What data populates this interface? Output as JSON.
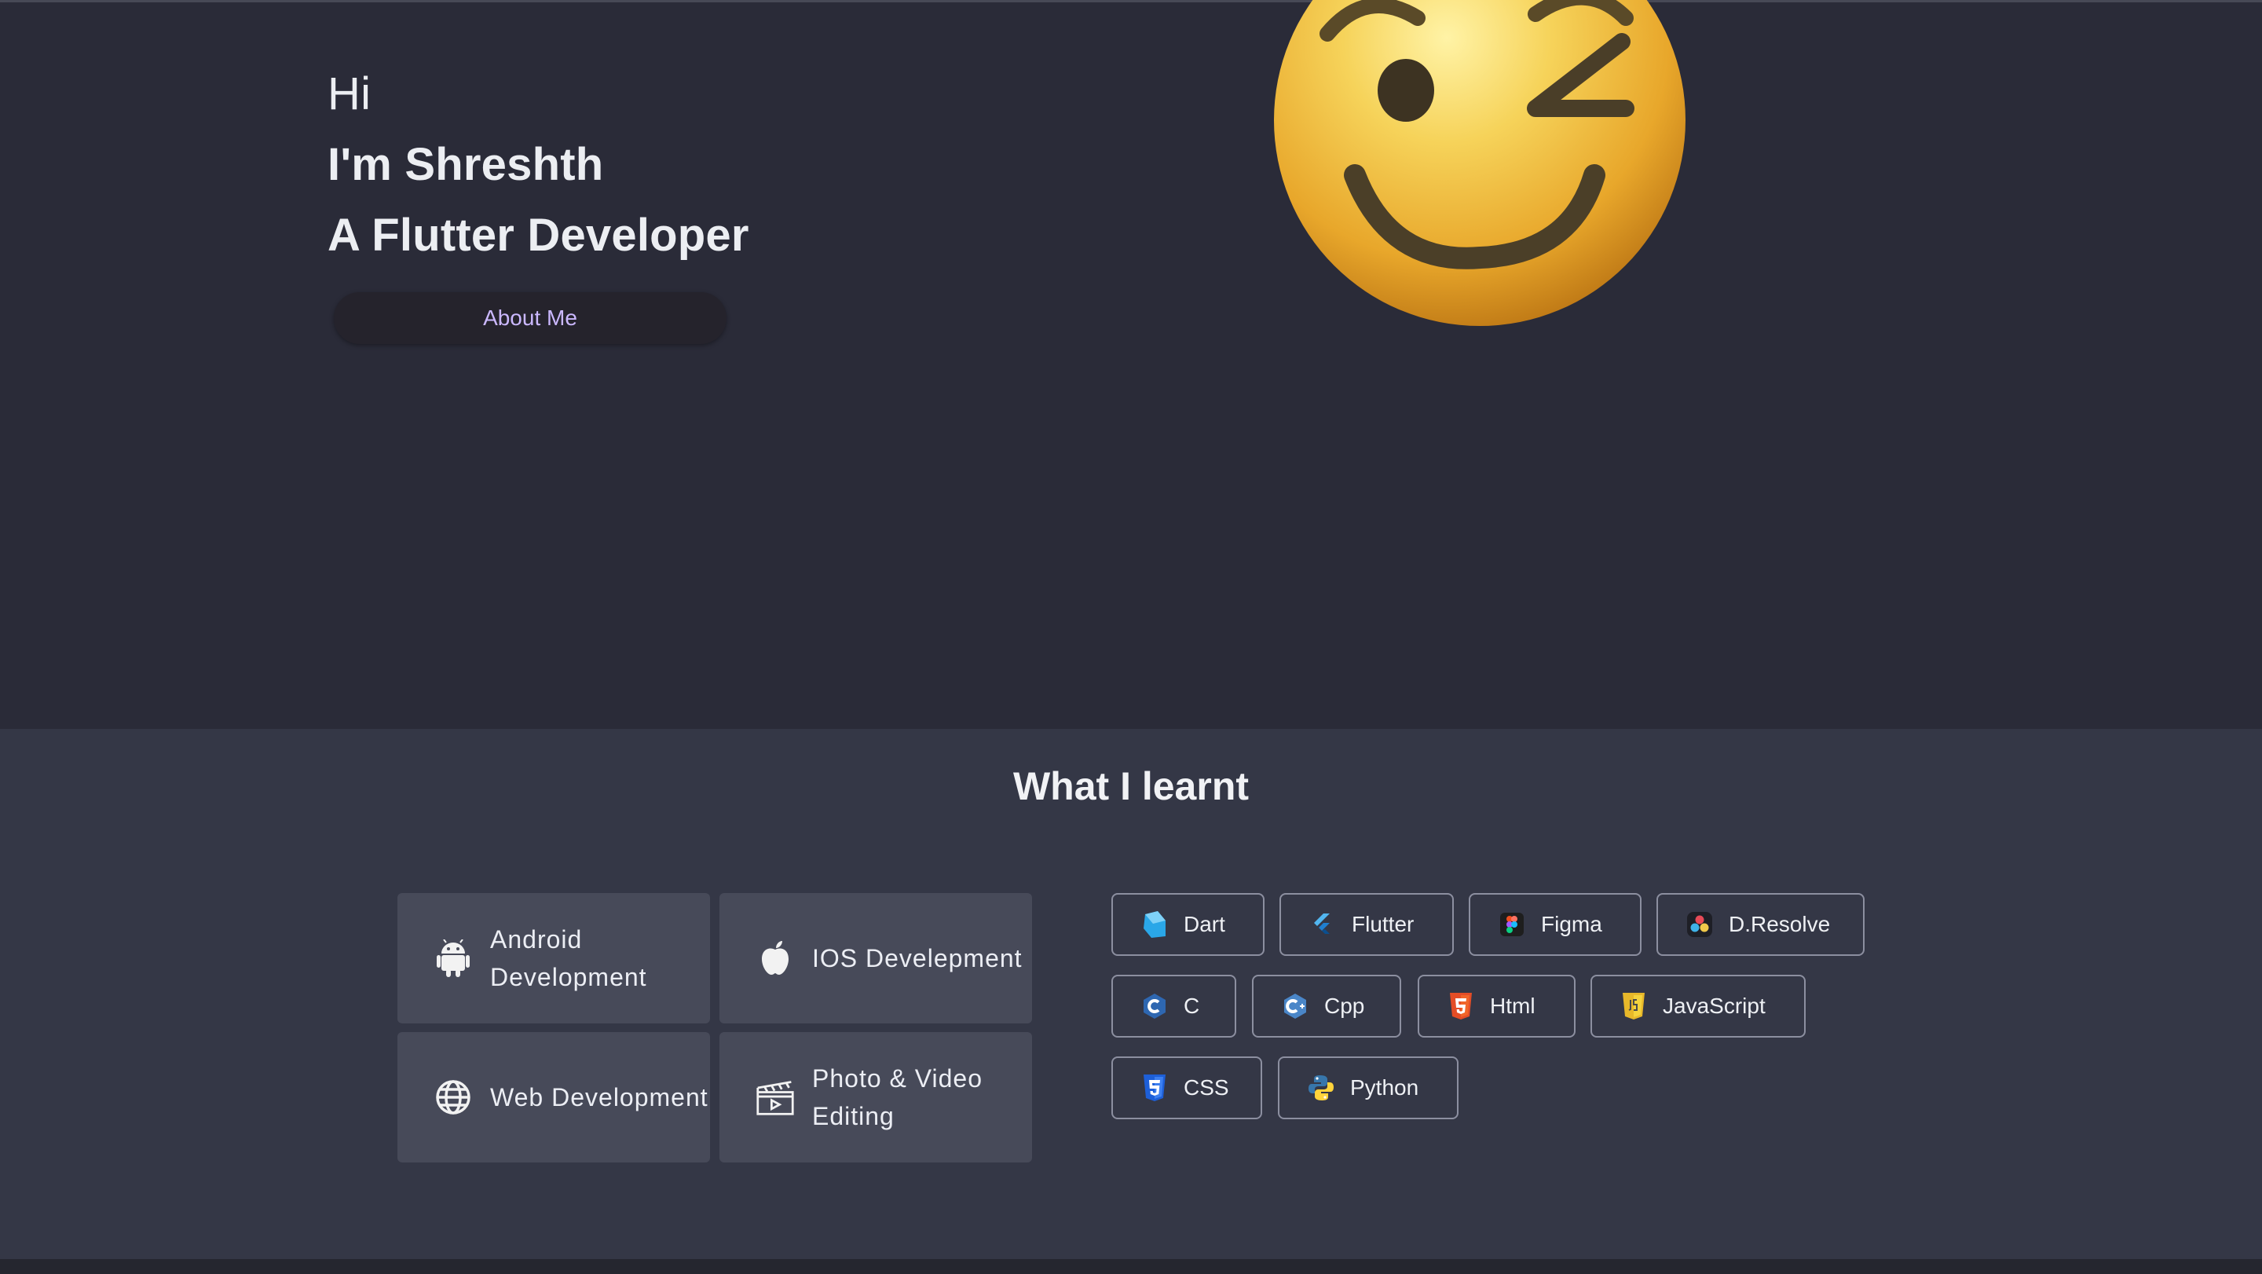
{
  "hero": {
    "line1": "Hi",
    "line2": "I'm Shreshth",
    "line3": "A Flutter Developer",
    "button_label": "About Me",
    "emoji": "winking-face-emoji"
  },
  "learnt": {
    "title": "What I learnt",
    "cards": [
      {
        "label": "Android Development",
        "icon": "android-icon"
      },
      {
        "label": "IOS Develepment",
        "icon": "apple-icon"
      },
      {
        "label": "Web Development",
        "icon": "globe-icon"
      },
      {
        "label": "Photo & Video Editing",
        "icon": "clapperboard-icon"
      }
    ],
    "skills": [
      {
        "label": "Dart",
        "icon": "dart-icon"
      },
      {
        "label": "Flutter",
        "icon": "flutter-icon"
      },
      {
        "label": "Figma",
        "icon": "figma-icon"
      },
      {
        "label": "D.Resolve",
        "icon": "davinci-resolve-icon"
      },
      {
        "label": "C",
        "icon": "c-icon"
      },
      {
        "label": "Cpp",
        "icon": "cpp-icon"
      },
      {
        "label": "Html",
        "icon": "html5-icon"
      },
      {
        "label": "JavaScript",
        "icon": "javascript-icon"
      },
      {
        "label": "CSS",
        "icon": "css3-icon"
      },
      {
        "label": "Python",
        "icon": "python-icon"
      }
    ]
  },
  "colors": {
    "hero_bg": "#2a2b38",
    "section_bg": "#343746",
    "card_bg": "#474a59",
    "accent": "#cbb8ff"
  }
}
